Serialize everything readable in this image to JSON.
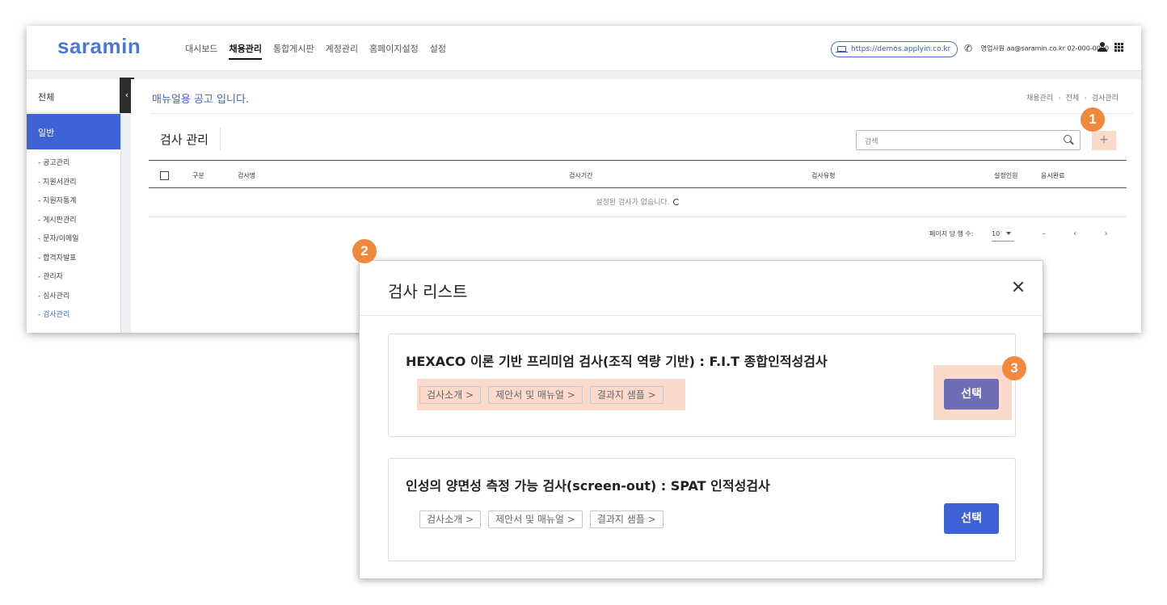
{
  "header": {
    "logo": "saramin",
    "nav": [
      "대시보드",
      "채용관리",
      "통합게시판",
      "계정관리",
      "홈페이지설정",
      "설정"
    ],
    "url": "https://demos.applyin.co.kr",
    "contact": "영업사원 aa@saramin.co.kr 02-000-0000"
  },
  "sidebar": {
    "all_label": "전체",
    "group_label": "일반",
    "items": [
      "- 공고관리",
      "- 지원서관리",
      "- 지원자통계",
      "- 게시판관리",
      "- 문자/이메일",
      "- 합격자발표",
      "- 관리자",
      "- 심사관리",
      "- 검사관리"
    ],
    "collapse_glyph": "‹"
  },
  "content": {
    "notice": "매뉴얼용 공고 입니다.",
    "breadcrumb": [
      "채용관리",
      "전체",
      "검사관리"
    ],
    "page_title": "검사 관리",
    "search_placeholder": "검색",
    "add_glyph": "+",
    "table": {
      "headers": [
        "구분",
        "검사명",
        "검사기간",
        "검사유형",
        "설정인원",
        "응시완료"
      ],
      "empty_message": "설정된 검사가 없습니다."
    },
    "pager": {
      "per_page_label": "페이지 당 행 수:",
      "per_page_value": "10",
      "range": "–",
      "prev": "‹",
      "next": "›"
    }
  },
  "modal": {
    "title": "검사 리스트",
    "tests": [
      {
        "title": "HEXACO 이론 기반 프리미엄 검사(조직 역량 기반) : F.I.T 종합인적성검사",
        "links": [
          "검사소개 >",
          "제안서 및 매뉴얼 >",
          "결과지 샘플 >"
        ],
        "select_label": "선택"
      },
      {
        "title": "인성의 양면성 측정 가능 검사(screen-out) : SPAT 인적성검사",
        "links": [
          "검사소개 >",
          "제안서 및 매뉴얼 >",
          "결과지 샘플 >"
        ],
        "select_label": "선택"
      }
    ]
  },
  "badges": [
    "1",
    "2",
    "3"
  ],
  "colors": {
    "accent": "#3f63d6",
    "highlight": "#fbd9cb",
    "badge": "#f0883e",
    "selected_button": "#6d6cb6"
  }
}
